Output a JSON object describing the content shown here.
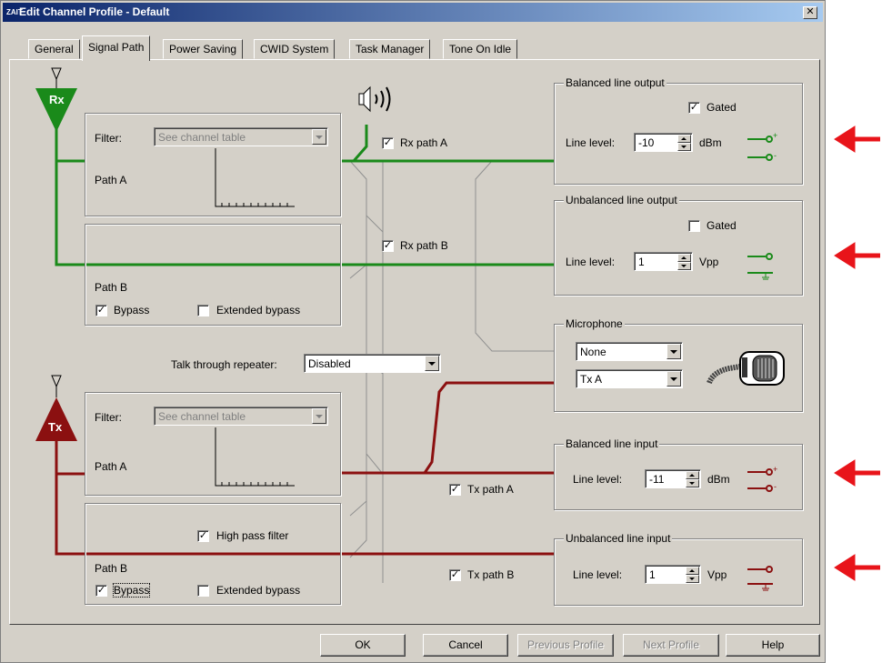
{
  "window": {
    "title": "Edit Channel Profile - Default",
    "icon_text": "ZAIT",
    "close_label": "✕"
  },
  "tabs": [
    {
      "label": "General"
    },
    {
      "label": "Signal Path"
    },
    {
      "label": "Power Saving"
    },
    {
      "label": "CWID System"
    },
    {
      "label": "Task Manager"
    },
    {
      "label": "Tone On Idle"
    }
  ],
  "rx": {
    "badge": "Rx",
    "path_a": {
      "filter_label": "Filter:",
      "filter_value": "See channel table",
      "label": "Path A"
    },
    "path_b": {
      "label": "Path B",
      "bypass_label": "Bypass",
      "bypass_checked": true,
      "extended_label": "Extended bypass",
      "extended_checked": false
    },
    "rx_path_a": {
      "label": "Rx path A",
      "checked": true
    },
    "rx_path_b": {
      "label": "Rx path B",
      "checked": true
    }
  },
  "talk_through": {
    "label": "Talk through repeater:",
    "value": "Disabled"
  },
  "tx": {
    "badge": "Tx",
    "path_a": {
      "filter_label": "Filter:",
      "filter_value": "See channel table",
      "label": "Path A"
    },
    "path_b": {
      "label": "Path B",
      "high_pass_label": "High pass filter",
      "high_pass_checked": true,
      "bypass_label": "Bypass",
      "bypass_checked": true,
      "extended_label": "Extended bypass",
      "extended_checked": false
    },
    "tx_path_a": {
      "label": "Tx path A",
      "checked": true
    },
    "tx_path_b": {
      "label": "Tx path B",
      "checked": true
    }
  },
  "balanced_output": {
    "title": "Balanced line output",
    "gated_label": "Gated",
    "gated_checked": true,
    "level_label": "Line level:",
    "level_value": "-10",
    "unit": "dBm"
  },
  "unbalanced_output": {
    "title": "Unbalanced line output",
    "gated_label": "Gated",
    "gated_checked": false,
    "level_label": "Line level:",
    "level_value": "1",
    "unit": "Vpp"
  },
  "microphone": {
    "title": "Microphone",
    "source_value": "None",
    "path_value": "Tx A"
  },
  "balanced_input": {
    "title": "Balanced line input",
    "level_label": "Line level:",
    "level_value": "-11",
    "unit": "dBm"
  },
  "unbalanced_input": {
    "title": "Unbalanced line input",
    "level_label": "Line level:",
    "level_value": "1",
    "unit": "Vpp"
  },
  "buttons": {
    "ok": "OK",
    "cancel": "Cancel",
    "previous": "Previous Profile",
    "next": "Next Profile",
    "help": "Help"
  },
  "colors": {
    "rx_green": "#1a8a1a",
    "tx_red": "#8b1010",
    "arrow_red": "#e8141a",
    "gray_wire": "#909090"
  },
  "icons": [
    "antenna-icon",
    "speaker-icon",
    "microphone-icon",
    "connector-icon",
    "red-arrow-icon"
  ]
}
